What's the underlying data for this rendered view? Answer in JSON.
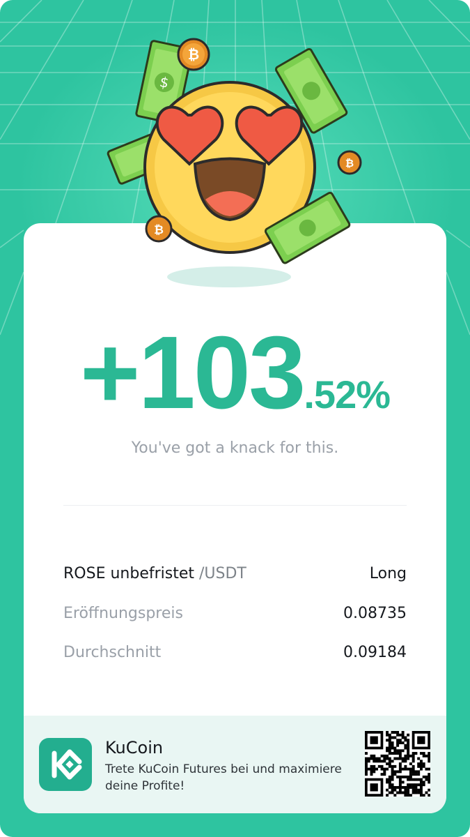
{
  "result": {
    "percent_integer": "+103",
    "percent_decimal": ".52%",
    "tagline": "You've got a knack for this."
  },
  "position": {
    "pair_main": "ROSE unbefristet",
    "pair_quote": "/USDT",
    "side": "Long",
    "entry_label": "Eröffnungspreis",
    "entry_value": "0.08735",
    "average_label": "Durchschnitt",
    "average_value": "0.09184"
  },
  "footer": {
    "brand": "KuCoin",
    "cta": "Trete KuCoin Futures bei und maximiere deine Profite!",
    "logo_icon": "kucoin-logo-icon",
    "qr_icon": "qr-code-icon"
  },
  "colors": {
    "background": "#2ec4a0",
    "accent": "#2bb894",
    "footer_bg": "#e9f6f3"
  }
}
